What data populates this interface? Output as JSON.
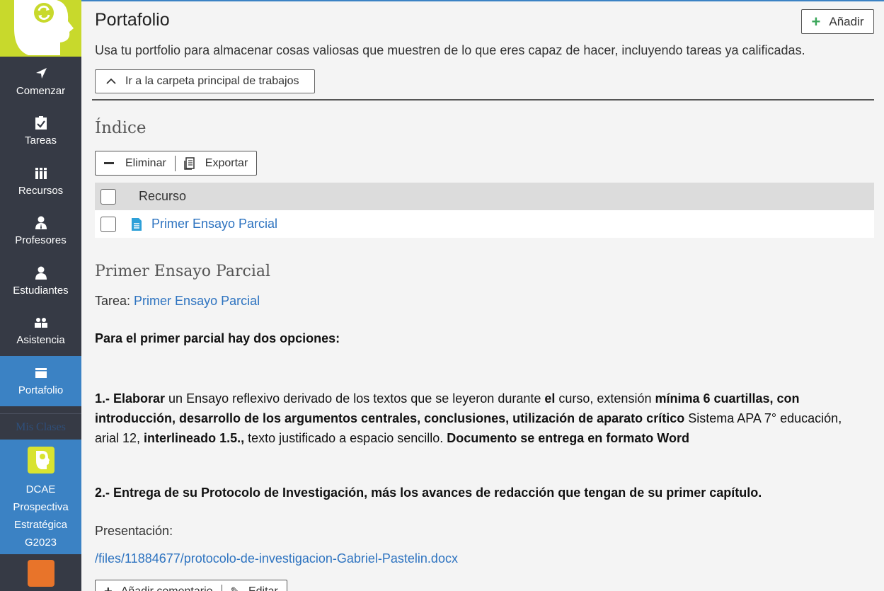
{
  "sidebar": {
    "nav": [
      {
        "label": "Comenzar",
        "icon": "navigation-arrow-icon"
      },
      {
        "label": "Tareas",
        "icon": "checklist-icon"
      },
      {
        "label": "Recursos",
        "icon": "books-icon"
      },
      {
        "label": "Profesores",
        "icon": "teacher-icon"
      },
      {
        "label": "Estudiantes",
        "icon": "student-icon"
      },
      {
        "label": "Asistencia",
        "icon": "attendance-icon"
      },
      {
        "label": "Portafolio",
        "icon": "folder-icon",
        "active": true
      }
    ],
    "my_classes_label": "Mis Clases",
    "class_name": "DCAE Prospectiva Estratégica G2023"
  },
  "header": {
    "title": "Portafolio",
    "add_label": "Añadir",
    "subtitle": "Usa tu portfolio para almacenar cosas valiosas que muestren de lo que eres capaz de hacer, incluyendo tareas ya calificadas.",
    "folder_button": "Ir a la carpeta principal de trabajos"
  },
  "index": {
    "title": "Índice",
    "delete_label": "Eliminar",
    "export_label": "Exportar",
    "column_header": "Recurso",
    "rows": [
      {
        "name": "Primer Ensayo Parcial"
      }
    ]
  },
  "item": {
    "title": "Primer Ensayo Parcial",
    "task_prefix": "Tarea:",
    "task_link": "Primer Ensayo Parcial",
    "intro": "Para el primer parcial hay dos opciones:",
    "option1_a": "1.- Elaborar",
    "option1_b": " un Ensayo reflexivo derivado de los textos que se leyeron durante ",
    "option1_c": "el",
    "option1_d": " curso, extensión ",
    "option1_e": "mínima 6 cuartillas, con introducción, desarrollo de los argumentos centrales, conclusiones, utilización de aparato crítico",
    "option1_f": " Sistema APA 7° educación, arial 12, ",
    "option1_g": "interlineado 1.5.,",
    "option1_h": " texto justificado a espacio sencillo. ",
    "option1_i": "Documento se entrega en formato Word",
    "option2": "2.- Entrega de su Protocolo de Investigación, más los avances de redacción que tengan de su primer capítulo.",
    "presentation_label": "Presentación:",
    "file_link": "/files/11884677/protocolo-de-investigacion-Gabriel-Pastelin.docx",
    "add_comment_label": "Añadir comentario",
    "edit_label": "Editar"
  },
  "colors": {
    "sidebar_bg": "#363a45",
    "accent_blue": "#3b82c4",
    "logo_green": "#c8d92c",
    "link_blue": "#2d73c0",
    "add_green": "#3aa65a"
  }
}
